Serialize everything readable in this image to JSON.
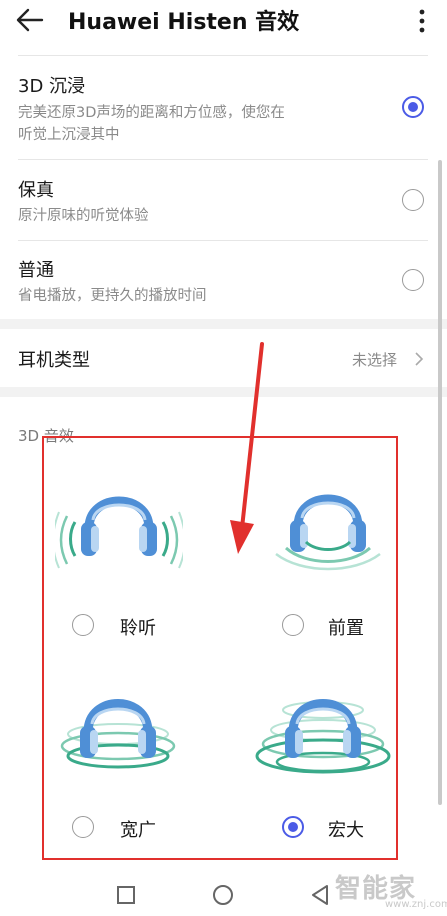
{
  "header": {
    "title": "Huawei Histen 音效",
    "back_icon": "back-arrow-icon",
    "more_icon": "more-vertical-icon"
  },
  "sound_modes": [
    {
      "title": "3D 沉浸",
      "description_lines": [
        "完美还原3D声场的距离和方位感，使您在",
        "听觉上沉浸其中"
      ],
      "selected": true
    },
    {
      "title": "保真",
      "description_lines": [
        "原汁原味的听觉体验"
      ],
      "selected": false
    },
    {
      "title": "普通",
      "description_lines": [
        "省电播放，更持久的播放时间"
      ],
      "selected": false
    }
  ],
  "headphone_type": {
    "label": "耳机类型",
    "value": "未选择",
    "chevron_icon": "chevron-right-icon"
  },
  "effects_section": {
    "label": "3D 音效",
    "options": [
      {
        "label": "聆听",
        "selected": false,
        "icon": "headphones-listen-icon"
      },
      {
        "label": "前置",
        "selected": false,
        "icon": "headphones-front-icon"
      },
      {
        "label": "宽广",
        "selected": false,
        "icon": "headphones-wide-icon"
      },
      {
        "label": "宏大",
        "selected": true,
        "icon": "headphones-grand-icon"
      }
    ]
  },
  "annotation": {
    "arrow_color": "#e1302d",
    "box_color": "#e1302d"
  },
  "navbar": {
    "icons": [
      "square-nav-icon",
      "circle-home-icon",
      "triangle-back-icon"
    ]
  },
  "watermark": {
    "text": "智能家",
    "url": "www.znj.com"
  },
  "colors": {
    "accent": "#4b5be6",
    "headphone_blue": "#4f8fd6",
    "wave_green": "#3aaa8a"
  }
}
